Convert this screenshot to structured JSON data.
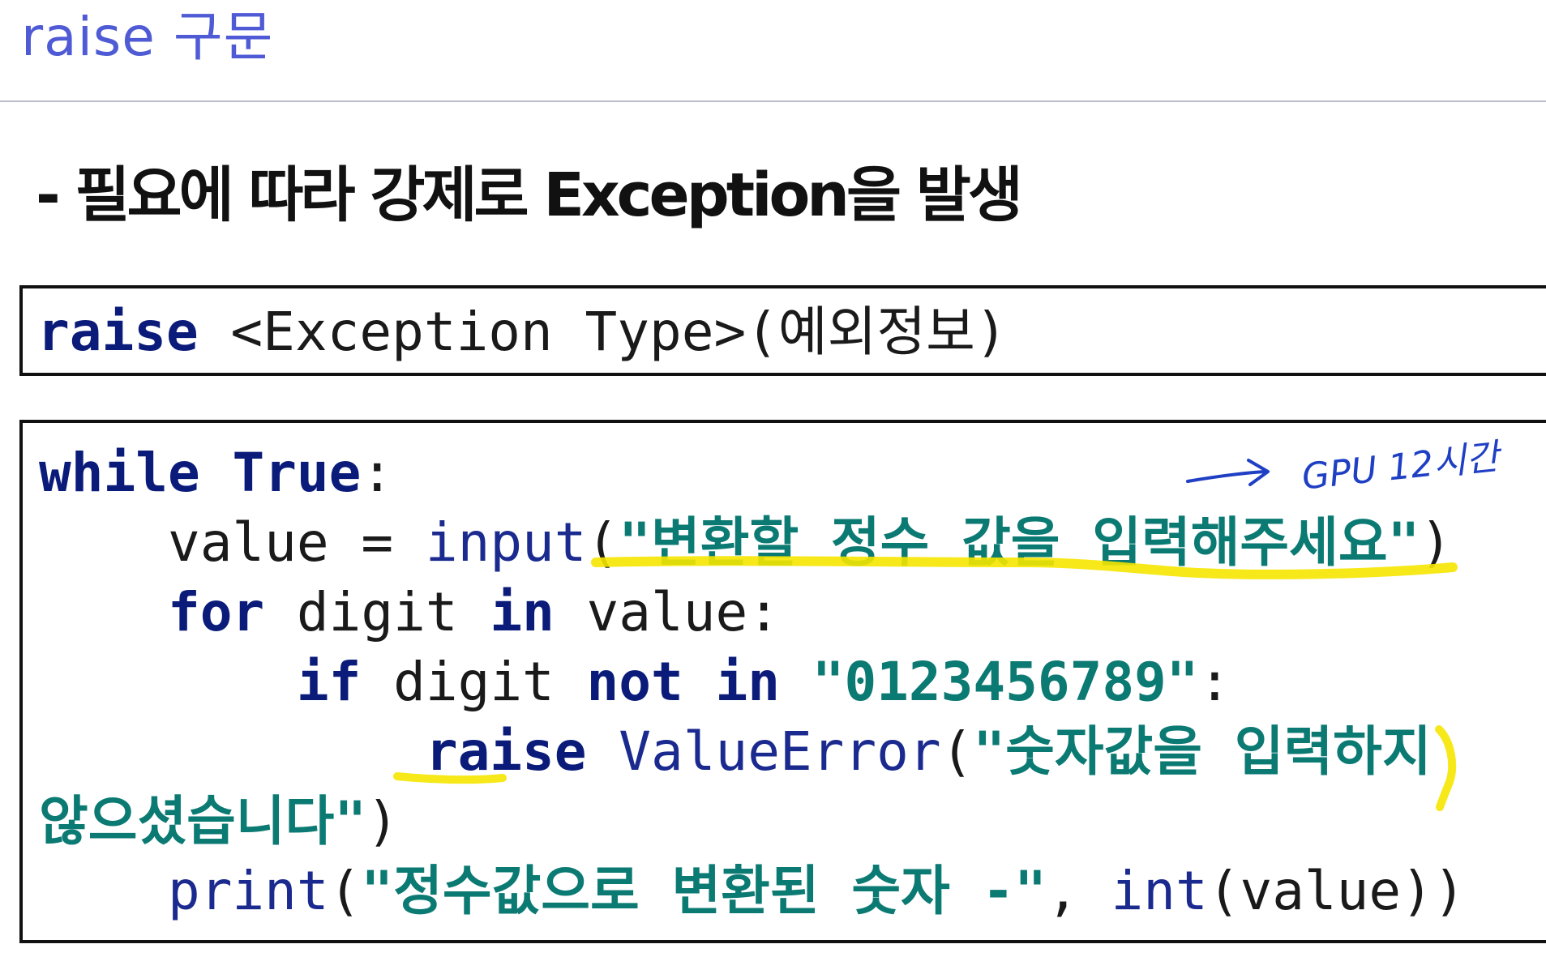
{
  "header": {
    "title": "raise 구문"
  },
  "subtitle": "- 필요에 따라 강제로 Exception을 발생",
  "syntax": {
    "keyword": "raise",
    "rest": " <Exception Type>(예외정보)"
  },
  "code": {
    "line1": {
      "kw1": "while",
      "sp": " ",
      "kw2": "True",
      "colon": ":"
    },
    "line2": {
      "indent": "    ",
      "var": "value = ",
      "fn": "input",
      "open": "(",
      "str": "\"변환할 정수 값을 입력해주세요\"",
      "close": ")"
    },
    "line3": {
      "indent": "    ",
      "kw1": "for",
      "mid": " digit ",
      "kw2": "in",
      "end": " value:"
    },
    "line4": {
      "indent": "        ",
      "kw1": "if",
      "mid": " digit ",
      "kw2": "not in",
      "sp": " ",
      "str": "\"0123456789\"",
      "colon": ":"
    },
    "line5": {
      "indent": "            ",
      "kw": "raise",
      "sp": " ",
      "fn": "ValueError",
      "open": "(",
      "str": "\"숫자값을 입력하지"
    },
    "line6": {
      "str": "않으셨습니다\"",
      "close": ")"
    },
    "line7": {
      "indent": "    ",
      "fn": "print",
      "open": "(",
      "str": "\"정수값으로 변환된 숫자 -\"",
      "comma": ", ",
      "fn2": "int",
      "rest": "(value))"
    }
  },
  "annotations": {
    "handwritten_note": "GPU 12시간",
    "highlight_color": "#f5e500",
    "pen_color": "#1f3fc4"
  }
}
